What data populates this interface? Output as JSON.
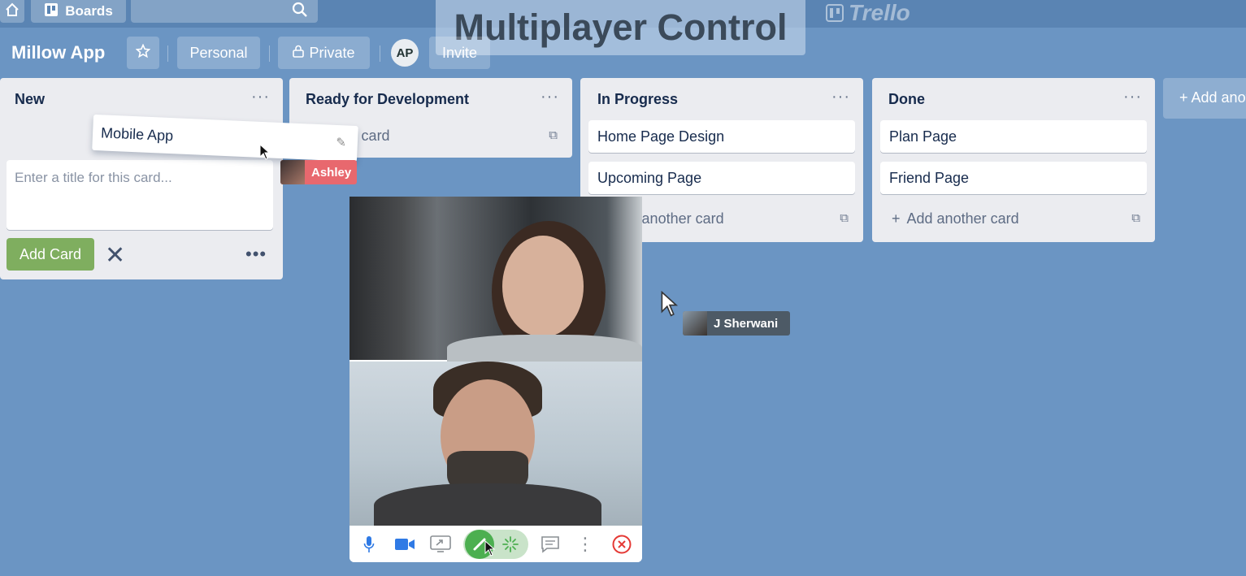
{
  "topbar": {
    "boards_label": "Boards"
  },
  "overlay": {
    "title": "Multiplayer Control"
  },
  "brand": {
    "logo_text": "Trello"
  },
  "board": {
    "title": "Millow App",
    "personal_label": "Personal",
    "private_label": "Private",
    "avatar_initials": "AP",
    "invite_label": "Invite"
  },
  "lists": [
    {
      "title": "New",
      "composer_placeholder": "Enter a title for this card...",
      "add_button": "Add Card"
    },
    {
      "title": "Ready for Development",
      "add_label": "Add a card"
    },
    {
      "title": "In Progress",
      "cards": [
        "Home Page Design",
        "Upcoming Page"
      ],
      "add_label": "Add another card"
    },
    {
      "title": "Done",
      "cards": [
        "Plan Page",
        "Friend Page"
      ],
      "add_label": "Add another card"
    }
  ],
  "add_list_label": "+ Add another list",
  "dragging_card": {
    "title": "Mobile App"
  },
  "collaborators": [
    {
      "name": "Ashley",
      "color": "#e8686e"
    },
    {
      "name": "J Sherwani",
      "color": "#4d5a66"
    }
  ],
  "colors": {
    "board_bg": "#6b95c3",
    "add_button": "#7fae5f",
    "list_bg": "#ebecf0"
  }
}
